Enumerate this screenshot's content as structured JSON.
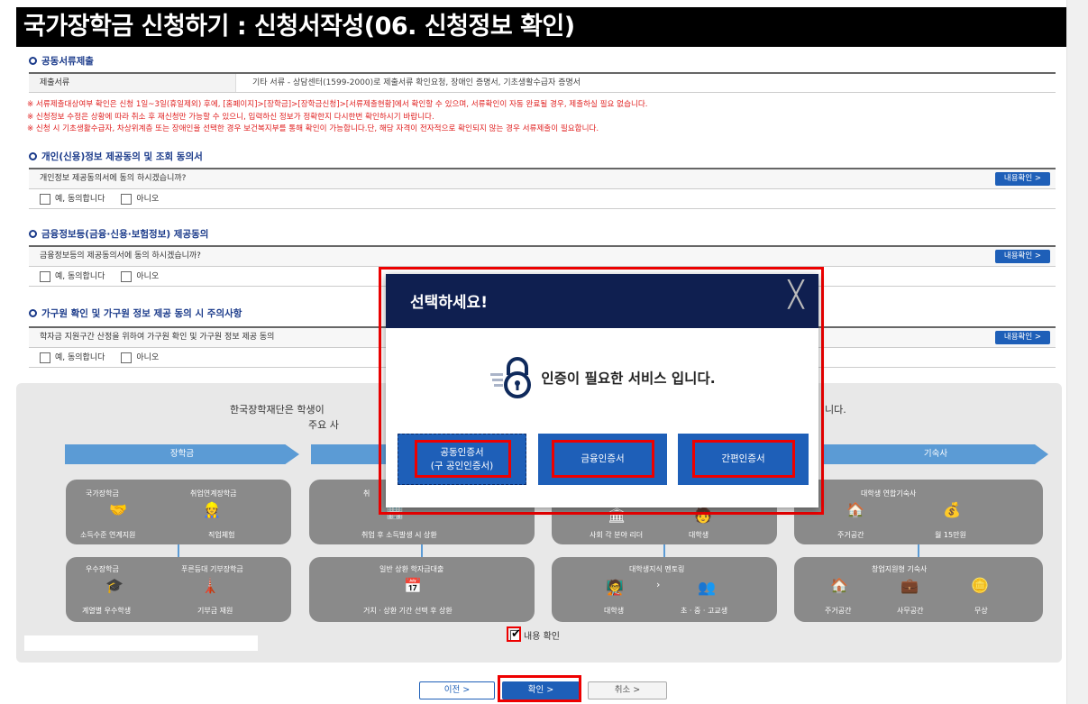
{
  "header": {
    "title": "국가장학금 신청하기 : 신청서작성(06. 신청정보 확인)"
  },
  "docs": {
    "title": "공동서류제출",
    "label": "제출서류",
    "value": "기타 서류 - 상담센터(1599-2000)로 제출서류 확인요청, 장애인 증명서, 기초생활수급자 증명서"
  },
  "notes": [
    "※ 서류제출대상여부 확인은 신청 1일~3일(휴일제외) 후에, [홈페이지]>[장학금]>[장학금신청]>[서류제출현황]에서 확인할 수 있으며, 서류확인이 자동 완료될 경우, 제출하실 필요 없습니다.",
    "※ 신청정보 수정은 상황에 따라 취소 후 재신청만 가능할 수 있으니, 입력하신 정보가 정확한지 다시한번 확인하시기 바랍니다.",
    "※ 신청 시 기초생활수급자, 차상위계층 또는 장애인을 선택한 경우 보건복지부를 통해 확인이 가능합니다.단, 해당 자격이 전자적으로 확인되지 않는 경우 서류제출이 필요합니다."
  ],
  "consents": [
    {
      "title": "개인(신용)정보 제공동의 및 조회 동의서",
      "question": "개인정보 제공동의서에 동의 하시겠습니까?",
      "button": "내용확인 >",
      "yes": "예, 동의합니다",
      "no": "아니오"
    },
    {
      "title": "금융정보등(금융·신용·보험정보) 제공동의",
      "question": "금융정보등의 제공동의서에 동의 하시겠습니까?",
      "button": "내용확인 >",
      "yes": "예, 동의합니다",
      "no": "아니오"
    },
    {
      "title": "가구원 확인 및 가구원 정보 제공 동의 시 주의사항",
      "question": "학자금 지원구간 산정을 위하여 가구원 확인 및 가구원 정보 제공 동의",
      "button": "내용확인 >",
      "yes": "예, 동의합니다",
      "no": "아니오"
    }
  ],
  "info": {
    "line1_left": "한국장학재단은 학생이",
    "line1_right": "니다.",
    "line2": "주요 사",
    "categories": [
      "장학금",
      "기숙사"
    ],
    "cards": {
      "c1": {
        "items": [
          "국가장학금",
          "취업연계장학금"
        ],
        "subs": [
          "소득수준 연계지원",
          "직업체험"
        ]
      },
      "c2": {
        "items": [
          "우수장학금",
          "푸른등대 기부장학금"
        ],
        "subs": [
          "계열별 우수학생",
          "기부금 재원"
        ]
      },
      "c3": {
        "items": [
          "취"
        ],
        "subs": [
          "취업 후 소득발생 시 상환"
        ]
      },
      "c4": {
        "items": [
          "일반 상환 학자금대출"
        ],
        "subs": [
          "거치 · 상환 기간 선택 후 상환"
        ]
      },
      "c5": {
        "subs": [
          "사회 각 분야 리더",
          "대학생"
        ]
      },
      "c6": {
        "items": [
          "대학생지식 멘토링"
        ],
        "subs": [
          "대학생",
          "초 · 중 · 고교생"
        ]
      },
      "c7": {
        "items": [
          "대학생 연합기숙사"
        ],
        "subs": [
          "주거공간",
          "월 15만원"
        ]
      },
      "c8": {
        "items": [
          "창업지원형 기숙사"
        ],
        "subs": [
          "주거공간",
          "사무공간",
          "무상"
        ]
      }
    },
    "agree_label": "내용 확인"
  },
  "buttons": {
    "prev": "이전 >",
    "ok": "확인 >",
    "cancel": "취소 >"
  },
  "modal": {
    "title": "선택하세요!",
    "close": "╳",
    "message": "인증이 필요한 서비스 입니다.",
    "cert1": "공동인증서\n(구 공인인증서)",
    "cert2": "금융인증서",
    "cert3": "간편인증서"
  },
  "colors": {
    "header_bg": "#000000",
    "accent": "#1e5fb8",
    "modal_head": "#0f1f50",
    "highlight": "#e00000",
    "notice": "#e02020"
  }
}
